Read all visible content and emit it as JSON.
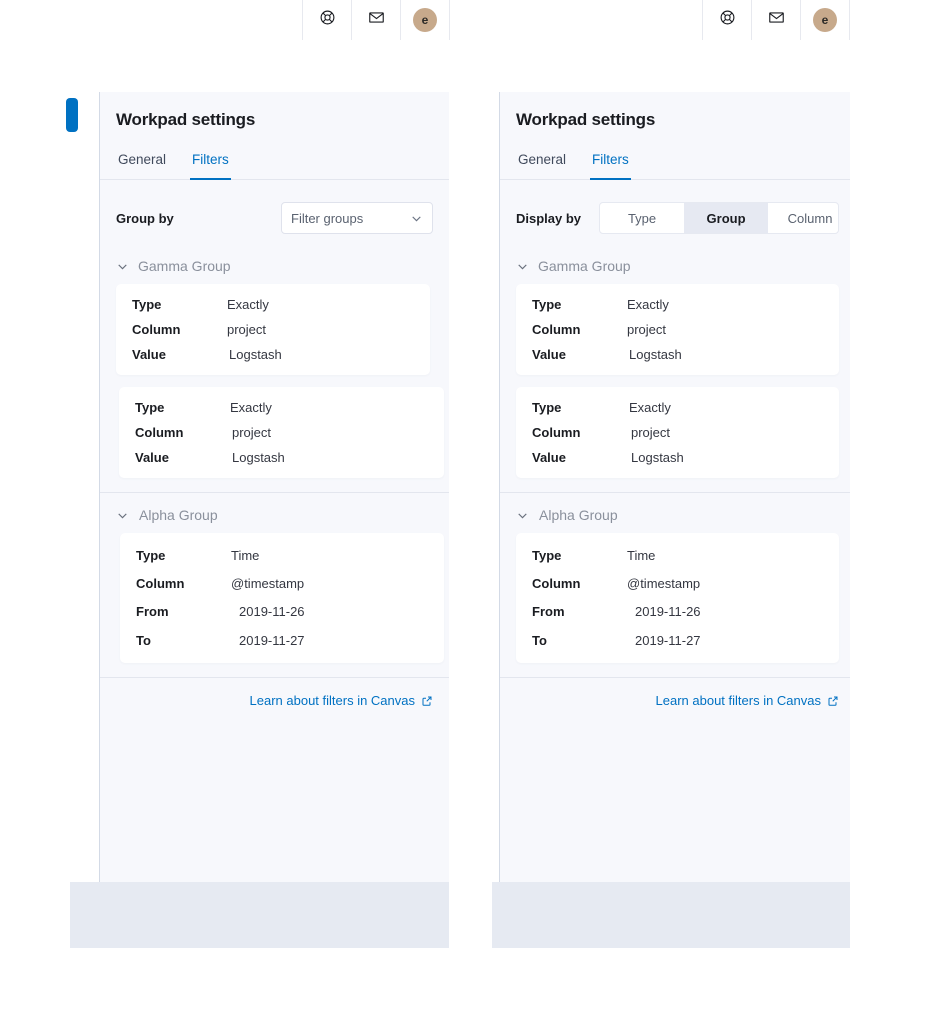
{
  "topbar": {
    "icons": [
      {
        "name": "help-lifebuoy-icon",
        "label": "Help"
      },
      {
        "name": "mail-envelope-icon",
        "label": "Notifications"
      }
    ],
    "avatar_initial": "e"
  },
  "colors": {
    "accent": "#0071c2",
    "panel_bg": "#f7f8fc",
    "card_bg": "#ffffff",
    "border": "#d3dae6",
    "muted_text": "#8a909c",
    "selected_btn_bg": "#e6e9f2",
    "bottom_strip": "#e6eaf2",
    "avatar_bg": "#c7a98b"
  },
  "panels": [
    {
      "id": "left",
      "title": "Workpad settings",
      "tabs": [
        {
          "label": "General",
          "active": false
        },
        {
          "label": "Filters",
          "active": true
        }
      ],
      "control": {
        "kind": "select",
        "label": "Group by",
        "value": "Filter groups",
        "placeholder": "Filter groups"
      },
      "groups": [
        {
          "name": "Gamma Group",
          "expanded": true,
          "cards": [
            {
              "rows": [
                {
                  "key": "Type",
                  "value": "Exactly"
                },
                {
                  "key": "Column",
                  "value": "project"
                },
                {
                  "key": "Value",
                  "value": "Logstash"
                }
              ]
            },
            {
              "rows": [
                {
                  "key": "Type",
                  "value": "Exactly"
                },
                {
                  "key": "Column",
                  "value": "project"
                },
                {
                  "key": "Value",
                  "value": "Logstash"
                }
              ]
            }
          ]
        },
        {
          "name": "Alpha Group",
          "expanded": true,
          "cards": [
            {
              "rows": [
                {
                  "key": "Type",
                  "value": "Time"
                },
                {
                  "key": "Column",
                  "value": "@timestamp"
                },
                {
                  "key": "From",
                  "value": "2019-11-26"
                },
                {
                  "key": "To",
                  "value": "2019-11-27"
                }
              ]
            }
          ]
        }
      ],
      "footer_link": "Learn about filters in Canvas"
    },
    {
      "id": "right",
      "title": "Workpad settings",
      "tabs": [
        {
          "label": "General",
          "active": false
        },
        {
          "label": "Filters",
          "active": true
        }
      ],
      "control": {
        "kind": "buttongroup",
        "label": "Display by",
        "options": [
          {
            "label": "Type",
            "selected": false
          },
          {
            "label": "Group",
            "selected": true
          },
          {
            "label": "Column",
            "selected": false
          }
        ]
      },
      "groups": [
        {
          "name": "Gamma Group",
          "expanded": true,
          "cards": [
            {
              "rows": [
                {
                  "key": "Type",
                  "value": "Exactly"
                },
                {
                  "key": "Column",
                  "value": "project"
                },
                {
                  "key": "Value",
                  "value": "Logstash"
                }
              ]
            },
            {
              "rows": [
                {
                  "key": "Type",
                  "value": "Exactly"
                },
                {
                  "key": "Column",
                  "value": "project"
                },
                {
                  "key": "Value",
                  "value": "Logstash"
                }
              ]
            }
          ]
        },
        {
          "name": "Alpha Group",
          "expanded": true,
          "cards": [
            {
              "rows": [
                {
                  "key": "Type",
                  "value": "Time"
                },
                {
                  "key": "Column",
                  "value": "@timestamp"
                },
                {
                  "key": "From",
                  "value": "2019-11-26"
                },
                {
                  "key": "To",
                  "value": "2019-11-27"
                }
              ]
            }
          ]
        }
      ],
      "footer_link": "Learn about filters in Canvas"
    }
  ]
}
